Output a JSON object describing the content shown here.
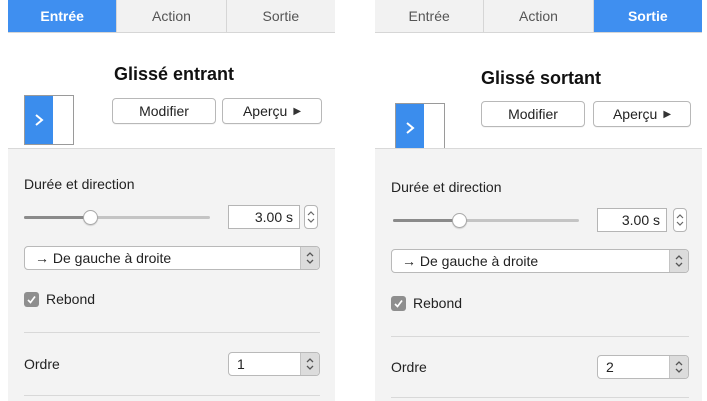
{
  "left": {
    "tabs": [
      "Entrée",
      "Action",
      "Sortie"
    ],
    "active_tab": 0,
    "effect_title": "Glissé entrant",
    "modify_label": "Modifier",
    "preview_label": "Aperçu",
    "duration_label": "Durée et direction",
    "duration_value": "3.00 s",
    "slider_fraction": 0.37,
    "direction_label": "→  De gauche à droite",
    "bounce_label": "Rebond",
    "bounce_checked": true,
    "order_label": "Ordre",
    "order_value": "1"
  },
  "right": {
    "tabs": [
      "Entrée",
      "Action",
      "Sortie"
    ],
    "active_tab": 2,
    "effect_title": "Glissé sortant",
    "modify_label": "Modifier",
    "preview_label": "Aperçu",
    "duration_label": "Durée et direction",
    "duration_value": "3.00 s",
    "slider_fraction": 0.37,
    "direction_label": "→  De gauche à droite",
    "bounce_label": "Rebond",
    "bounce_checked": true,
    "order_label": "Ordre",
    "order_value": "2"
  },
  "colors": {
    "accent": "#3f8ff0",
    "panel_bg": "#f3f3f3"
  }
}
